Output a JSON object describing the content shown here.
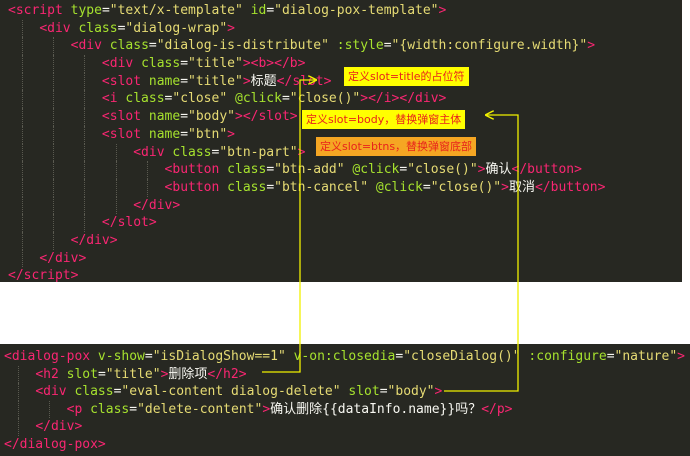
{
  "colors": {
    "editor_bg": "#272822",
    "tag": "#f92672",
    "attribute": "#a6e22e",
    "string": "#e6db74",
    "text": "#f8f8f2",
    "note_yellow": "#ffff00",
    "note_orange": "#f5a623",
    "note_text": "#e8231b",
    "arrow": "#f0f000"
  },
  "template_code": [
    {
      "indent": 0,
      "tokens": [
        {
          "t": "tag",
          "v": "<script"
        },
        {
          "t": "punc",
          "v": " "
        },
        {
          "t": "attr",
          "v": "type"
        },
        {
          "t": "punc",
          "v": "="
        },
        {
          "t": "str",
          "v": "\"text/x-template\""
        },
        {
          "t": "punc",
          "v": " "
        },
        {
          "t": "attr",
          "v": "id"
        },
        {
          "t": "punc",
          "v": "="
        },
        {
          "t": "str",
          "v": "\"dialog-pox-template\""
        },
        {
          "t": "tag",
          "v": ">"
        }
      ]
    },
    {
      "indent": 1,
      "tokens": [
        {
          "t": "tag",
          "v": "<div"
        },
        {
          "t": "punc",
          "v": " "
        },
        {
          "t": "attr",
          "v": "class"
        },
        {
          "t": "punc",
          "v": "="
        },
        {
          "t": "str",
          "v": "\"dialog-wrap\""
        },
        {
          "t": "tag",
          "v": ">"
        }
      ]
    },
    {
      "indent": 2,
      "tokens": [
        {
          "t": "tag",
          "v": "<div"
        },
        {
          "t": "punc",
          "v": " "
        },
        {
          "t": "attr",
          "v": "class"
        },
        {
          "t": "punc",
          "v": "="
        },
        {
          "t": "str",
          "v": "\"dialog-is-distribute\""
        },
        {
          "t": "punc",
          "v": " "
        },
        {
          "t": "attr",
          "v": ":style"
        },
        {
          "t": "punc",
          "v": "="
        },
        {
          "t": "str",
          "v": "\"{width:configure.width}\""
        },
        {
          "t": "tag",
          "v": ">"
        }
      ]
    },
    {
      "indent": 3,
      "tokens": [
        {
          "t": "tag",
          "v": "<div"
        },
        {
          "t": "punc",
          "v": " "
        },
        {
          "t": "attr",
          "v": "class"
        },
        {
          "t": "punc",
          "v": "="
        },
        {
          "t": "str",
          "v": "\"title\""
        },
        {
          "t": "tag",
          "v": ">"
        },
        {
          "t": "tag",
          "v": "<b>"
        },
        {
          "t": "tag",
          "v": "</b>"
        }
      ]
    },
    {
      "indent": 3,
      "tokens": [
        {
          "t": "tag",
          "v": "<slot"
        },
        {
          "t": "punc",
          "v": " "
        },
        {
          "t": "attr",
          "v": "name"
        },
        {
          "t": "punc",
          "v": "="
        },
        {
          "t": "str",
          "v": "\"title\""
        },
        {
          "t": "tag",
          "v": ">"
        },
        {
          "t": "txt",
          "v": "标题"
        },
        {
          "t": "tag",
          "v": "</slot>"
        }
      ]
    },
    {
      "indent": 3,
      "tokens": [
        {
          "t": "tag",
          "v": "<i"
        },
        {
          "t": "punc",
          "v": " "
        },
        {
          "t": "attr",
          "v": "class"
        },
        {
          "t": "punc",
          "v": "="
        },
        {
          "t": "str",
          "v": "\"close\""
        },
        {
          "t": "punc",
          "v": " "
        },
        {
          "t": "attr",
          "v": "@click"
        },
        {
          "t": "punc",
          "v": "="
        },
        {
          "t": "str",
          "v": "\"close()\""
        },
        {
          "t": "tag",
          "v": ">"
        },
        {
          "t": "tag",
          "v": "</i>"
        },
        {
          "t": "tag",
          "v": "</div>"
        }
      ]
    },
    {
      "indent": 3,
      "tokens": [
        {
          "t": "tag",
          "v": "<slot"
        },
        {
          "t": "punc",
          "v": " "
        },
        {
          "t": "attr",
          "v": "name"
        },
        {
          "t": "punc",
          "v": "="
        },
        {
          "t": "str",
          "v": "\"body\""
        },
        {
          "t": "tag",
          "v": ">"
        },
        {
          "t": "tag",
          "v": "</slot>"
        }
      ]
    },
    {
      "indent": 3,
      "tokens": [
        {
          "t": "tag",
          "v": "<slot"
        },
        {
          "t": "punc",
          "v": " "
        },
        {
          "t": "attr",
          "v": "name"
        },
        {
          "t": "punc",
          "v": "="
        },
        {
          "t": "str",
          "v": "\"btn\""
        },
        {
          "t": "tag",
          "v": ">"
        }
      ]
    },
    {
      "indent": 4,
      "tokens": [
        {
          "t": "tag",
          "v": "<div"
        },
        {
          "t": "punc",
          "v": " "
        },
        {
          "t": "attr",
          "v": "class"
        },
        {
          "t": "punc",
          "v": "="
        },
        {
          "t": "str",
          "v": "\"btn-part\""
        },
        {
          "t": "tag",
          "v": ">"
        }
      ]
    },
    {
      "indent": 5,
      "tokens": [
        {
          "t": "tag",
          "v": "<button"
        },
        {
          "t": "punc",
          "v": " "
        },
        {
          "t": "attr",
          "v": "class"
        },
        {
          "t": "punc",
          "v": "="
        },
        {
          "t": "str",
          "v": "\"btn-add\""
        },
        {
          "t": "punc",
          "v": " "
        },
        {
          "t": "attr",
          "v": "@click"
        },
        {
          "t": "punc",
          "v": "="
        },
        {
          "t": "str",
          "v": "\"close()\""
        },
        {
          "t": "tag",
          "v": ">"
        },
        {
          "t": "txt",
          "v": "确认"
        },
        {
          "t": "tag",
          "v": "</button>"
        }
      ]
    },
    {
      "indent": 5,
      "tokens": [
        {
          "t": "tag",
          "v": "<button"
        },
        {
          "t": "punc",
          "v": " "
        },
        {
          "t": "attr",
          "v": "class"
        },
        {
          "t": "punc",
          "v": "="
        },
        {
          "t": "str",
          "v": "\"btn-cancel\""
        },
        {
          "t": "punc",
          "v": " "
        },
        {
          "t": "attr",
          "v": "@click"
        },
        {
          "t": "punc",
          "v": "="
        },
        {
          "t": "str",
          "v": "\"close()\""
        },
        {
          "t": "tag",
          "v": ">"
        },
        {
          "t": "txt",
          "v": "取消"
        },
        {
          "t": "tag",
          "v": "</button>"
        }
      ]
    },
    {
      "indent": 4,
      "tokens": [
        {
          "t": "tag",
          "v": "</div>"
        }
      ]
    },
    {
      "indent": 3,
      "tokens": [
        {
          "t": "tag",
          "v": "</slot>"
        }
      ]
    },
    {
      "indent": 2,
      "tokens": [
        {
          "t": "tag",
          "v": "</div>"
        }
      ]
    },
    {
      "indent": 1,
      "tokens": [
        {
          "t": "tag",
          "v": "</div>"
        }
      ]
    },
    {
      "indent": 0,
      "tokens": [
        {
          "t": "tag",
          "v": "</script"
        },
        {
          "t": "tag",
          "v": ">"
        }
      ]
    }
  ],
  "usage_code": [
    {
      "indent": 0,
      "tokens": [
        {
          "t": "tag",
          "v": "<dialog-pox"
        },
        {
          "t": "punc",
          "v": " "
        },
        {
          "t": "attr",
          "v": "v-show"
        },
        {
          "t": "punc",
          "v": "="
        },
        {
          "t": "str",
          "v": "\"isDialogShow==1\""
        },
        {
          "t": "punc",
          "v": " "
        },
        {
          "t": "attr",
          "v": "v-on:closedia"
        },
        {
          "t": "punc",
          "v": "="
        },
        {
          "t": "str",
          "v": "\"closeDialog()\""
        },
        {
          "t": "punc",
          "v": " "
        },
        {
          "t": "attr",
          "v": ":configure"
        },
        {
          "t": "punc",
          "v": "="
        },
        {
          "t": "str",
          "v": "\"nature\""
        },
        {
          "t": "tag",
          "v": ">"
        }
      ]
    },
    {
      "indent": 1,
      "tokens": [
        {
          "t": "tag",
          "v": "<h2"
        },
        {
          "t": "punc",
          "v": " "
        },
        {
          "t": "attr",
          "v": "slot"
        },
        {
          "t": "punc",
          "v": "="
        },
        {
          "t": "str",
          "v": "\"title\""
        },
        {
          "t": "tag",
          "v": ">"
        },
        {
          "t": "txt",
          "v": "删除项"
        },
        {
          "t": "tag",
          "v": "</h2>"
        }
      ]
    },
    {
      "indent": 1,
      "tokens": [
        {
          "t": "tag",
          "v": "<div"
        },
        {
          "t": "punc",
          "v": " "
        },
        {
          "t": "attr",
          "v": "class"
        },
        {
          "t": "punc",
          "v": "="
        },
        {
          "t": "str",
          "v": "\"eval-content dialog-delete\""
        },
        {
          "t": "punc",
          "v": " "
        },
        {
          "t": "attr",
          "v": "slot"
        },
        {
          "t": "punc",
          "v": "="
        },
        {
          "t": "str",
          "v": "\"body\""
        },
        {
          "t": "tag",
          "v": ">"
        }
      ]
    },
    {
      "indent": 2,
      "tokens": [
        {
          "t": "tag",
          "v": "<p"
        },
        {
          "t": "punc",
          "v": " "
        },
        {
          "t": "attr",
          "v": "class"
        },
        {
          "t": "punc",
          "v": "="
        },
        {
          "t": "str",
          "v": "\"delete-content\""
        },
        {
          "t": "tag",
          "v": ">"
        },
        {
          "t": "txt",
          "v": "确认删除{{dataInfo.name}}吗？"
        },
        {
          "t": "tag",
          "v": "</p>"
        }
      ]
    },
    {
      "indent": 1,
      "tokens": [
        {
          "t": "tag",
          "v": "</div>"
        }
      ]
    },
    {
      "indent": 0,
      "tokens": [
        {
          "t": "tag",
          "v": "</dialog-pox>"
        }
      ]
    }
  ],
  "annotations": {
    "note_title": "定义slot=title的占位符",
    "note_body": "定义slot=body，替换弹窗主体",
    "note_btns": "定义slot=btns，替换弹窗底部"
  }
}
